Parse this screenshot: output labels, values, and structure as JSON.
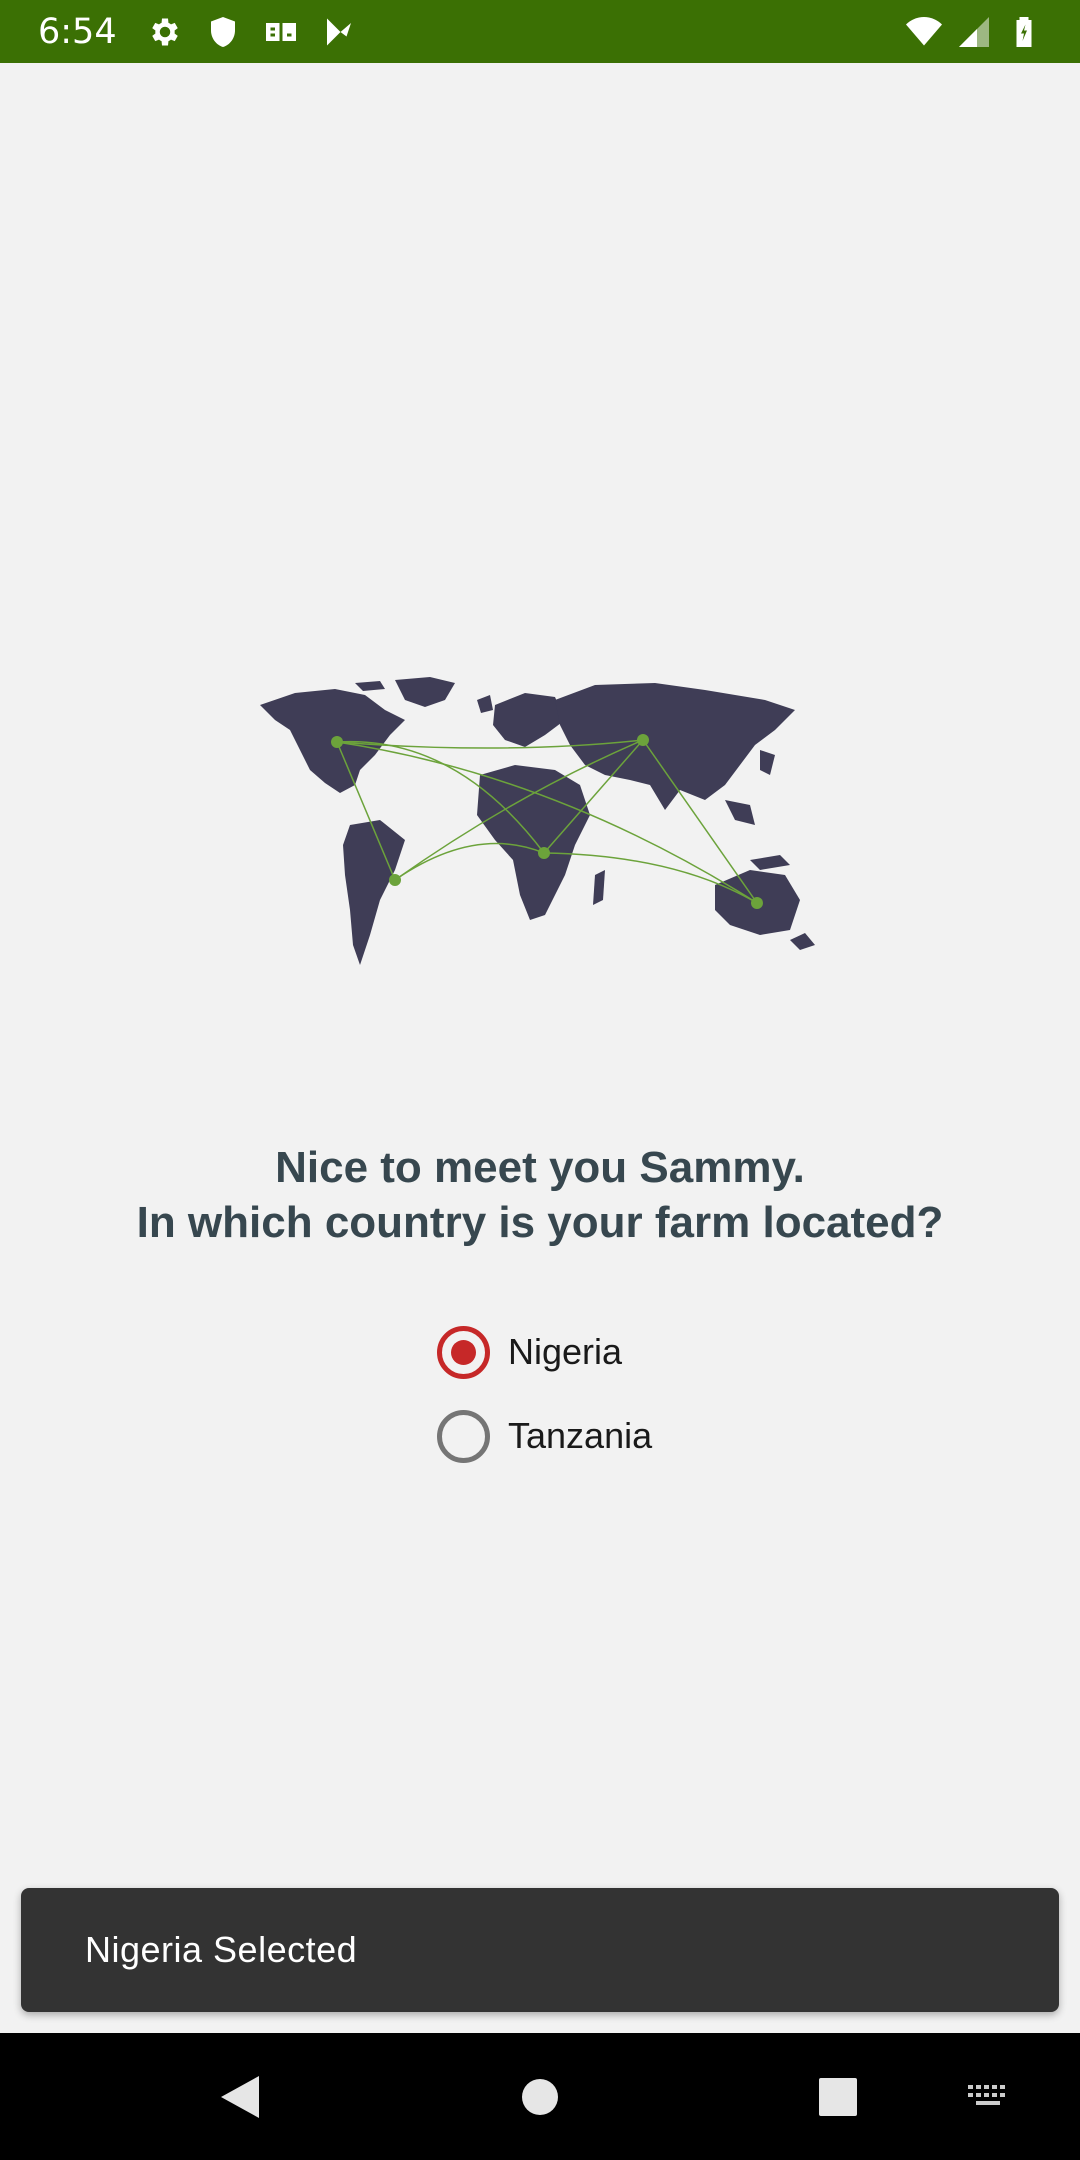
{
  "status_bar": {
    "time": "6:54",
    "left_icons": [
      "settings-icon",
      "shield-icon",
      "app-icon",
      "play-store-icon"
    ],
    "right_icons": [
      "wifi-icon",
      "signal-icon",
      "battery-icon"
    ],
    "background": "#3b7004"
  },
  "illustration": {
    "name": "world-map-illustration",
    "land_color": "#3f3d56",
    "connection_color": "#6ca33b"
  },
  "question": {
    "line1": "Nice to meet you Sammy.",
    "line2": "In which country is your farm located?"
  },
  "countries": {
    "options": [
      {
        "label": "Nigeria",
        "checked": true
      },
      {
        "label": "Tanzania",
        "checked": false
      }
    ],
    "accent": "#c62828"
  },
  "snackbar": {
    "message": "Nigeria Selected"
  },
  "nav_bar": {
    "buttons": [
      "back-icon",
      "home-icon",
      "recents-icon",
      "keyboard-icon"
    ]
  }
}
